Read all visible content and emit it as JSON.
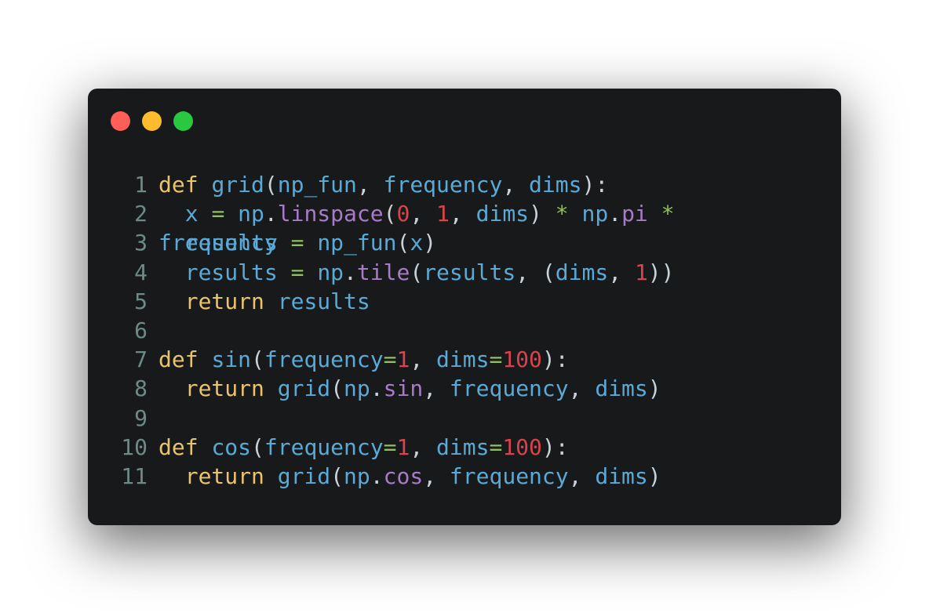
{
  "window": {
    "background": "#18191b",
    "traffic_lights": [
      {
        "name": "close",
        "color": "#ff5f57"
      },
      {
        "name": "minimize",
        "color": "#ffbd2e"
      },
      {
        "name": "zoom",
        "color": "#28c840"
      }
    ]
  },
  "colors": {
    "keyword": "#e9c46a",
    "function": "#5aa9d6",
    "identifier": "#5aa9d6",
    "method": "#a77bc5",
    "number": "#d9434b",
    "operator": "#8fbf5f",
    "punctuation": "#c9d1d9",
    "line_number": "#6e8a86"
  },
  "code": {
    "language": "python",
    "lines": [
      {
        "n": "1",
        "tokens": [
          {
            "t": "def",
            "c": "keyword"
          },
          {
            "t": " ",
            "c": "punctuation"
          },
          {
            "t": "grid",
            "c": "function"
          },
          {
            "t": "(",
            "c": "punctuation"
          },
          {
            "t": "np_fun",
            "c": "identifier"
          },
          {
            "t": ", ",
            "c": "punctuation"
          },
          {
            "t": "frequency",
            "c": "identifier"
          },
          {
            "t": ", ",
            "c": "punctuation"
          },
          {
            "t": "dims",
            "c": "identifier"
          },
          {
            "t": "):",
            "c": "punctuation"
          }
        ]
      },
      {
        "n": "2",
        "tokens": [
          {
            "t": "  ",
            "c": "punctuation"
          },
          {
            "t": "x",
            "c": "identifier"
          },
          {
            "t": " ",
            "c": "punctuation"
          },
          {
            "t": "=",
            "c": "operator"
          },
          {
            "t": " ",
            "c": "punctuation"
          },
          {
            "t": "np",
            "c": "identifier"
          },
          {
            "t": ".",
            "c": "punctuation"
          },
          {
            "t": "linspace",
            "c": "method"
          },
          {
            "t": "(",
            "c": "punctuation"
          },
          {
            "t": "0",
            "c": "number"
          },
          {
            "t": ", ",
            "c": "punctuation"
          },
          {
            "t": "1",
            "c": "number"
          },
          {
            "t": ", ",
            "c": "punctuation"
          },
          {
            "t": "dims",
            "c": "identifier"
          },
          {
            "t": ") ",
            "c": "punctuation"
          },
          {
            "t": "*",
            "c": "operator"
          },
          {
            "t": " ",
            "c": "punctuation"
          },
          {
            "t": "np",
            "c": "identifier"
          },
          {
            "t": ".",
            "c": "punctuation"
          },
          {
            "t": "pi",
            "c": "method"
          },
          {
            "t": " ",
            "c": "punctuation"
          },
          {
            "t": "*",
            "c": "operator"
          }
        ]
      },
      {
        "n": "3",
        "wrap_text": "frequency",
        "tokens": [
          {
            "t": "  ",
            "c": "punctuation"
          },
          {
            "t": "results",
            "c": "identifier"
          },
          {
            "t": " ",
            "c": "punctuation"
          },
          {
            "t": "=",
            "c": "operator"
          },
          {
            "t": " ",
            "c": "punctuation"
          },
          {
            "t": "np_fun",
            "c": "function"
          },
          {
            "t": "(",
            "c": "punctuation"
          },
          {
            "t": "x",
            "c": "identifier"
          },
          {
            "t": ")",
            "c": "punctuation"
          }
        ]
      },
      {
        "n": "4",
        "tokens": [
          {
            "t": "  ",
            "c": "punctuation"
          },
          {
            "t": "results",
            "c": "identifier"
          },
          {
            "t": " ",
            "c": "punctuation"
          },
          {
            "t": "=",
            "c": "operator"
          },
          {
            "t": " ",
            "c": "punctuation"
          },
          {
            "t": "np",
            "c": "identifier"
          },
          {
            "t": ".",
            "c": "punctuation"
          },
          {
            "t": "tile",
            "c": "method"
          },
          {
            "t": "(",
            "c": "punctuation"
          },
          {
            "t": "results",
            "c": "identifier"
          },
          {
            "t": ", (",
            "c": "punctuation"
          },
          {
            "t": "dims",
            "c": "identifier"
          },
          {
            "t": ", ",
            "c": "punctuation"
          },
          {
            "t": "1",
            "c": "number"
          },
          {
            "t": "))",
            "c": "punctuation"
          }
        ]
      },
      {
        "n": "5",
        "tokens": [
          {
            "t": "  ",
            "c": "punctuation"
          },
          {
            "t": "return",
            "c": "keyword"
          },
          {
            "t": " ",
            "c": "punctuation"
          },
          {
            "t": "results",
            "c": "identifier"
          }
        ]
      },
      {
        "n": "6",
        "tokens": []
      },
      {
        "n": "7",
        "tokens": [
          {
            "t": "def",
            "c": "keyword"
          },
          {
            "t": " ",
            "c": "punctuation"
          },
          {
            "t": "sin",
            "c": "function"
          },
          {
            "t": "(",
            "c": "punctuation"
          },
          {
            "t": "frequency",
            "c": "identifier"
          },
          {
            "t": "=",
            "c": "operator"
          },
          {
            "t": "1",
            "c": "number"
          },
          {
            "t": ", ",
            "c": "punctuation"
          },
          {
            "t": "dims",
            "c": "identifier"
          },
          {
            "t": "=",
            "c": "operator"
          },
          {
            "t": "100",
            "c": "number"
          },
          {
            "t": "):",
            "c": "punctuation"
          }
        ]
      },
      {
        "n": "8",
        "tokens": [
          {
            "t": "  ",
            "c": "punctuation"
          },
          {
            "t": "return",
            "c": "keyword"
          },
          {
            "t": " ",
            "c": "punctuation"
          },
          {
            "t": "grid",
            "c": "function"
          },
          {
            "t": "(",
            "c": "punctuation"
          },
          {
            "t": "np",
            "c": "identifier"
          },
          {
            "t": ".",
            "c": "punctuation"
          },
          {
            "t": "sin",
            "c": "method"
          },
          {
            "t": ", ",
            "c": "punctuation"
          },
          {
            "t": "frequency",
            "c": "identifier"
          },
          {
            "t": ", ",
            "c": "punctuation"
          },
          {
            "t": "dims",
            "c": "identifier"
          },
          {
            "t": ")",
            "c": "punctuation"
          }
        ]
      },
      {
        "n": "9",
        "tokens": []
      },
      {
        "n": "10",
        "tokens": [
          {
            "t": "def",
            "c": "keyword"
          },
          {
            "t": " ",
            "c": "punctuation"
          },
          {
            "t": "cos",
            "c": "function"
          },
          {
            "t": "(",
            "c": "punctuation"
          },
          {
            "t": "frequency",
            "c": "identifier"
          },
          {
            "t": "=",
            "c": "operator"
          },
          {
            "t": "1",
            "c": "number"
          },
          {
            "t": ", ",
            "c": "punctuation"
          },
          {
            "t": "dims",
            "c": "identifier"
          },
          {
            "t": "=",
            "c": "operator"
          },
          {
            "t": "100",
            "c": "number"
          },
          {
            "t": "):",
            "c": "punctuation"
          }
        ]
      },
      {
        "n": "11",
        "tokens": [
          {
            "t": "  ",
            "c": "punctuation"
          },
          {
            "t": "return",
            "c": "keyword"
          },
          {
            "t": " ",
            "c": "punctuation"
          },
          {
            "t": "grid",
            "c": "function"
          },
          {
            "t": "(",
            "c": "punctuation"
          },
          {
            "t": "np",
            "c": "identifier"
          },
          {
            "t": ".",
            "c": "punctuation"
          },
          {
            "t": "cos",
            "c": "method"
          },
          {
            "t": ", ",
            "c": "punctuation"
          },
          {
            "t": "frequency",
            "c": "identifier"
          },
          {
            "t": ", ",
            "c": "punctuation"
          },
          {
            "t": "dims",
            "c": "identifier"
          },
          {
            "t": ")",
            "c": "punctuation"
          }
        ]
      }
    ]
  }
}
